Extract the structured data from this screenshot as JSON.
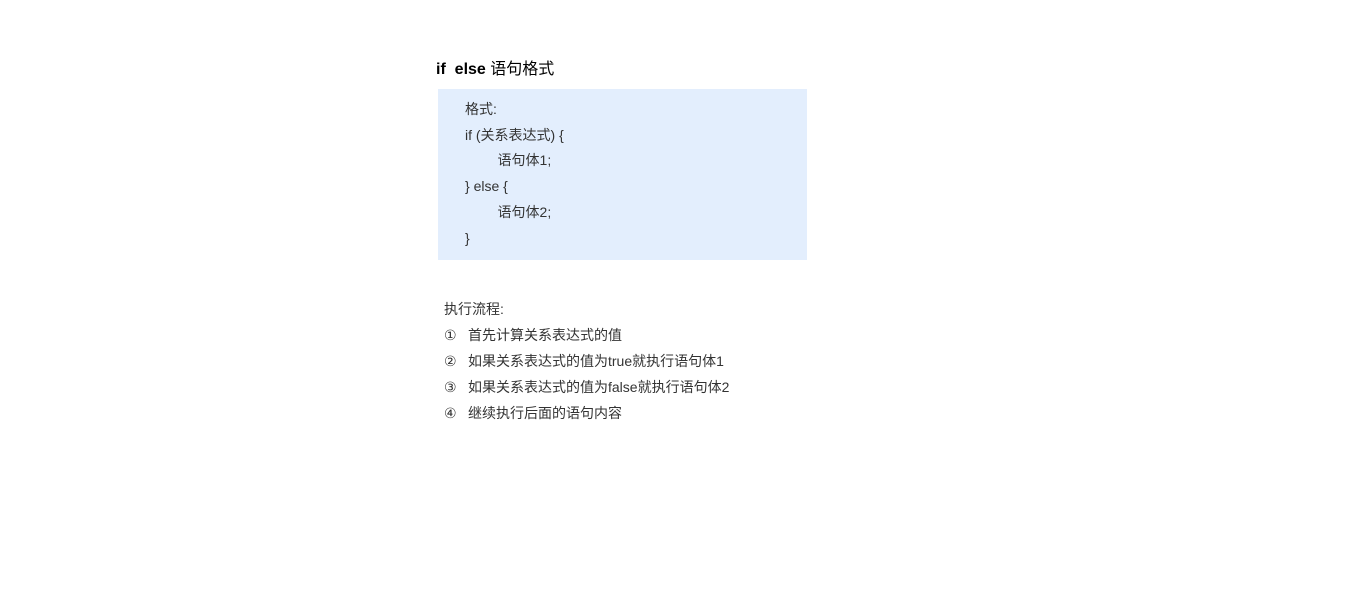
{
  "heading": {
    "kw1": "if",
    "kw2": "else",
    "rest": "语句格式"
  },
  "code": {
    "lines": [
      "格式:",
      "if (关系表达式) {",
      "    语句体1;",
      "} else {",
      "    语句体2;",
      "}"
    ]
  },
  "flow": {
    "title": "执行流程:",
    "steps": [
      {
        "num": "①",
        "text": "首先计算关系表达式的值"
      },
      {
        "num": "②",
        "text": "如果关系表达式的值为true就执行语句体1"
      },
      {
        "num": "③",
        "text": "如果关系表达式的值为false就执行语句体2"
      },
      {
        "num": "④",
        "text": "继续执行后面的语句内容"
      }
    ]
  }
}
